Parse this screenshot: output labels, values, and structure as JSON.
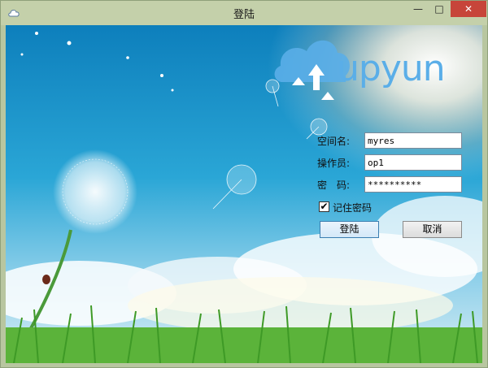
{
  "window": {
    "title": "登陆",
    "minimize_glyph": "—",
    "maximize_glyph": "□",
    "close_glyph": "✕"
  },
  "brand": {
    "logo_text": "upyun"
  },
  "form": {
    "space_label": "空间名:",
    "space_value": "myres",
    "operator_label": "操作员:",
    "operator_value": "op1",
    "password_label": "密　码:",
    "password_value": "**********",
    "remember_label": "记住密码",
    "remember_checked": true
  },
  "buttons": {
    "login": "登陆",
    "cancel": "取消"
  },
  "colors": {
    "accent": "#3c7fb1",
    "close": "#c7453a",
    "logo": "#5aaee8"
  },
  "icons": [
    "cloud-icon",
    "minimize-icon",
    "maximize-icon",
    "close-icon",
    "checkmark-icon"
  ]
}
